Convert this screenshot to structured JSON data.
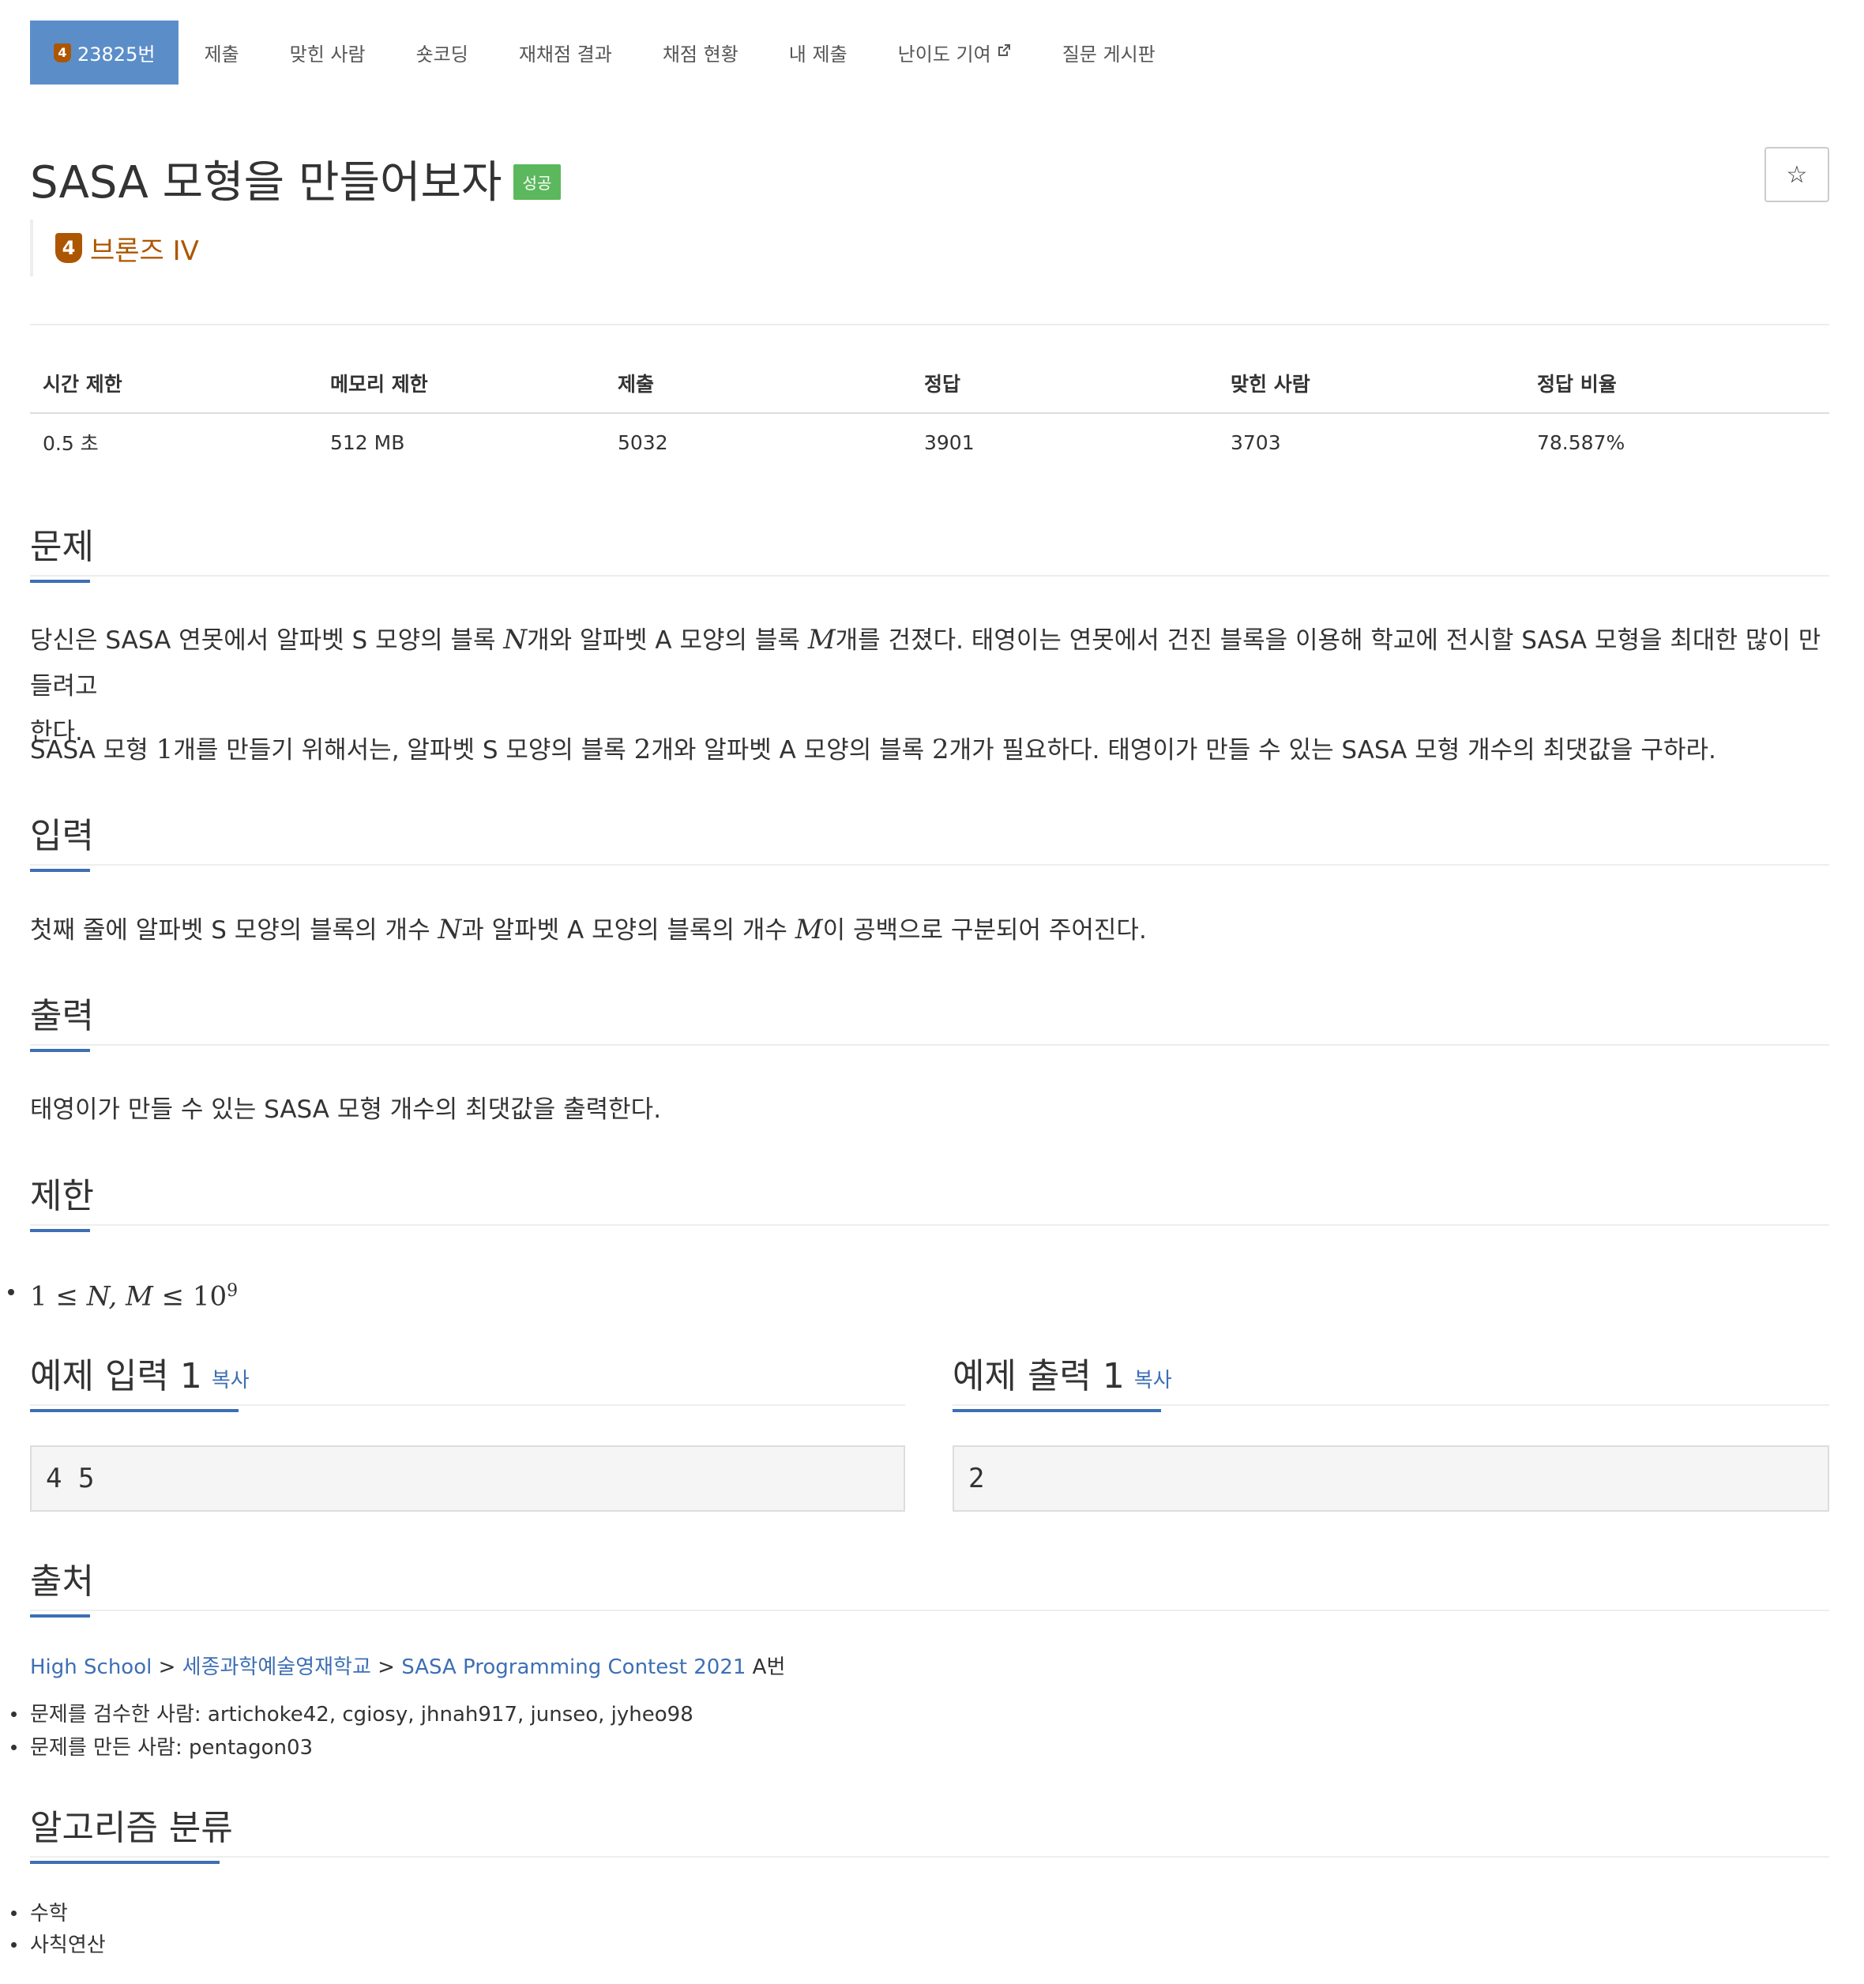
{
  "nav": {
    "problem_tab": "23825번",
    "items": [
      "제출",
      "맞힌 사람",
      "숏코딩",
      "재채점 결과",
      "채점 현황",
      "내 제출",
      "난이도 기여",
      "질문 게시판"
    ],
    "tier_number": "4"
  },
  "problem": {
    "title": "SASA 모형을 만들어보자",
    "result_badge": "성공",
    "star": "☆",
    "tier": "브론즈 IV"
  },
  "info": {
    "headers": [
      "시간 제한",
      "메모리 제한",
      "제출",
      "정답",
      "맞힌 사람",
      "정답 비율"
    ],
    "values": [
      "0.5 초",
      "512 MB",
      "5032",
      "3901",
      "3703",
      "78.587%"
    ]
  },
  "sections": {
    "problem": "문제",
    "input": "입력",
    "output": "출력",
    "limit": "제한",
    "sample_input": "예제 입력 1",
    "sample_output": "예제 출력 1",
    "copy": "복사",
    "source": "출처",
    "algorithm": "알고리즘 분류"
  },
  "statement": {
    "p1_a": "당신은 SASA 연못에서 알파벳 S 모양의 블록 ",
    "p1_N": "N",
    "p1_b": "개와 알파벳 A 모양의 블록 ",
    "p1_M": "M",
    "p1_c": "개를 건졌다. 태영이는 연못에서 건진 블록을 이용해 학교에 전시할 SASA 모형을 최대한 많이 만들려고",
    "p1_d": "한다.",
    "p2_a": "SASA 모형 ",
    "p2_1": "1",
    "p2_b": "개를 만들기 위해서는, 알파벳 S 모양의 블록 ",
    "p2_2": "2",
    "p2_c": "개와 알파벳 A 모양의 블록 ",
    "p2_3": "2",
    "p2_d": "개가 필요하다. 태영이가 만들 수 있는 SASA 모형 개수의 최댓값을 구하라."
  },
  "input_desc": {
    "a": "첫째 줄에 알파벳 S 모양의 블록의 개수 ",
    "N": "N",
    "b": "과 알파벳 A 모양의 블록의 개수 ",
    "M": "M",
    "c": "이 공백으로 구분되어 주어진다."
  },
  "output_desc": "태영이가 만들 수 있는 SASA 모형 개수의 최댓값을 출력한다.",
  "limit": {
    "one": "1",
    "le1": " ≤ ",
    "vars": "N, M",
    "le2": " ≤ ",
    "ten": "10",
    "exp": "9"
  },
  "samples": {
    "input": "4 5",
    "output": "2"
  },
  "source": {
    "l1": "High School",
    "sep1": " > ",
    "l2": "세종과학예술영재학교",
    "sep2": " > ",
    "l3": "SASA Programming Contest 2021",
    "suffix": " A번",
    "reviewers": "문제를 검수한 사람: artichoke42, cgiosy, jhnah917, junseo, jyheo98",
    "author": "문제를 만든 사람: pentagon03"
  },
  "algorithms": [
    "수학",
    "사칙연산"
  ],
  "colors": {
    "accent": "#5b8ec9",
    "link": "#3d6fb4",
    "bronze": "#ad5600",
    "success": "#5cb85c"
  }
}
